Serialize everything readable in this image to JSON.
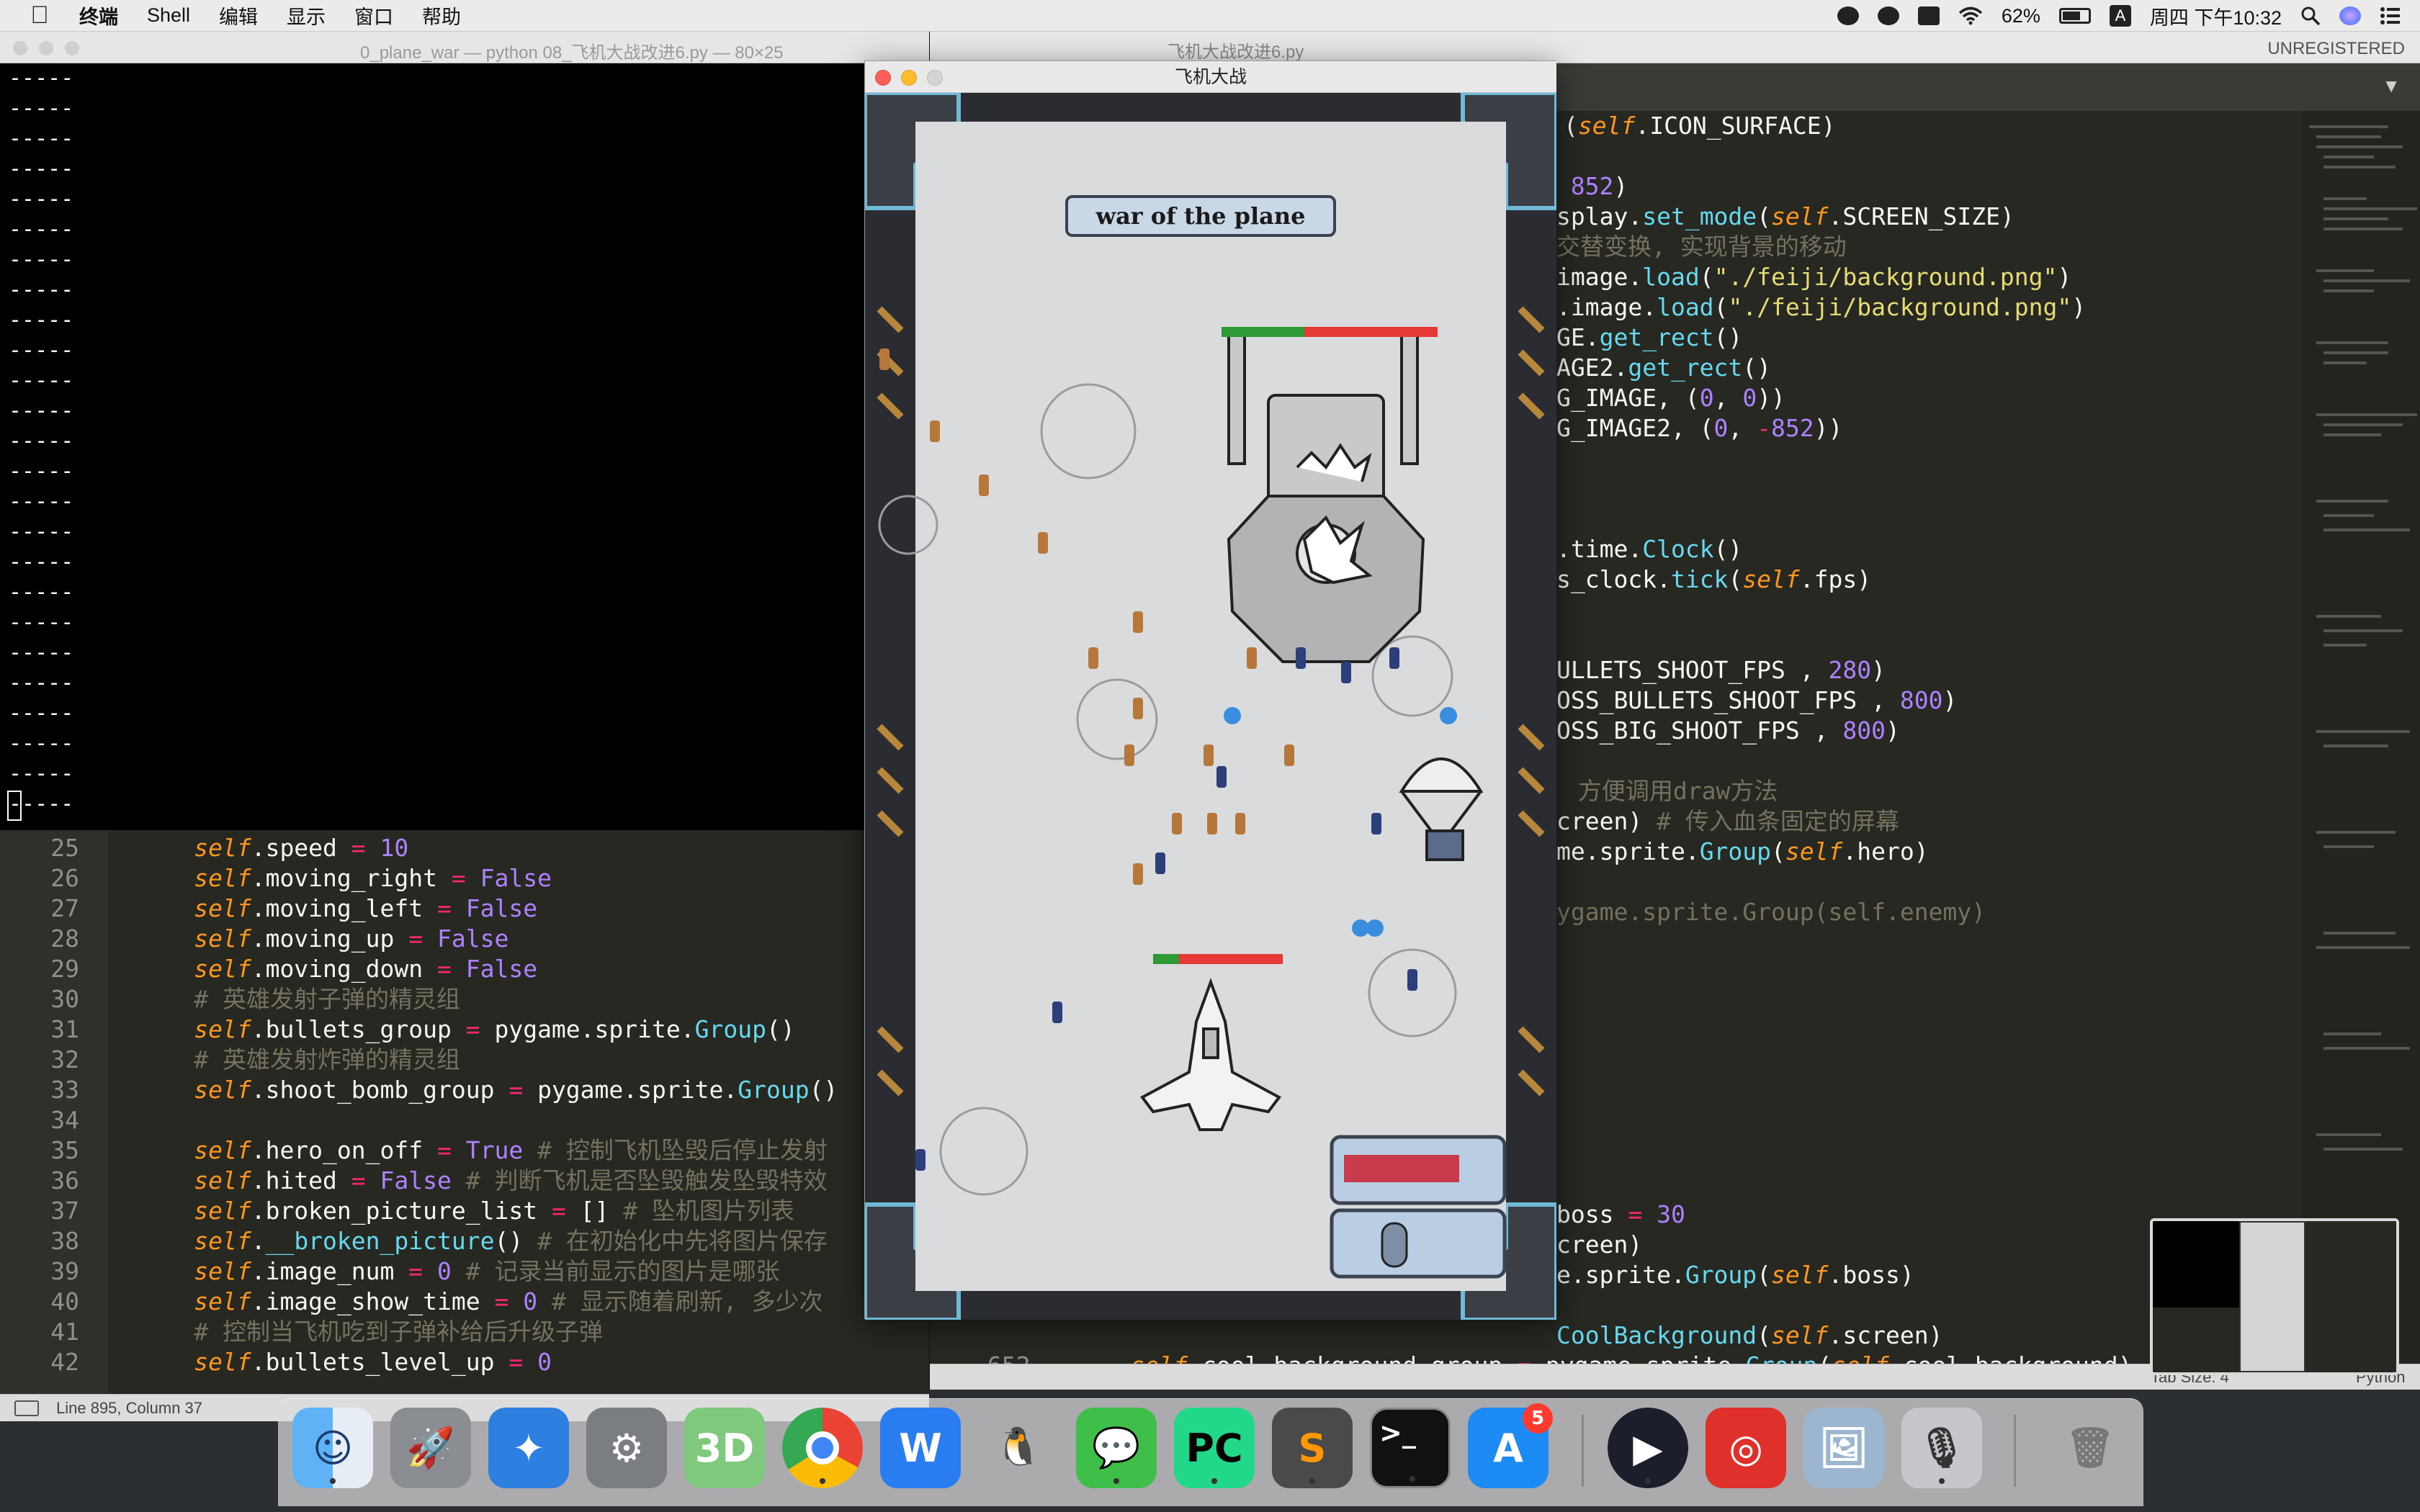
{
  "menubar": {
    "items": [
      "终端",
      "Shell",
      "编辑",
      "显示",
      "窗口",
      "帮助"
    ],
    "battery": "62%",
    "input_method": "A",
    "clock": "周四 下午10:32"
  },
  "terminal": {
    "title": "0_plane_war — python 08_飞机大战改进6.py — 80×25",
    "line_text": "-----",
    "status": "Line 895, Column 37"
  },
  "sublime": {
    "title": "飞机大战改进6.py",
    "unregistered": "UNREGISTERED",
    "tab_size": "Tab Size: 4",
    "syntax": "Python"
  },
  "game": {
    "title": "飞机大战",
    "banner": "war of the plane"
  },
  "dock": {
    "items": [
      "finder-icon",
      "launchpad-icon",
      "safari-icon",
      "system-preferences-icon",
      "maps-icon",
      "chrome-icon",
      "wps-icon",
      "qq-icon",
      "wechat-icon",
      "pycharm-icon",
      "sublime-icon",
      "terminal-icon",
      "appstore-icon",
      "quicktime-icon",
      "netease-music-icon",
      "preview-icon",
      "voice-icon",
      "trash-icon"
    ],
    "appstore_badge": "5",
    "pycharm_label": "PC",
    "terminal_prompt": ">_"
  },
  "colors": {
    "editor_bg": "#272822",
    "terminal_bg": "#000000",
    "hp_green": "#2e9a36",
    "hp_red": "#e53935"
  }
}
